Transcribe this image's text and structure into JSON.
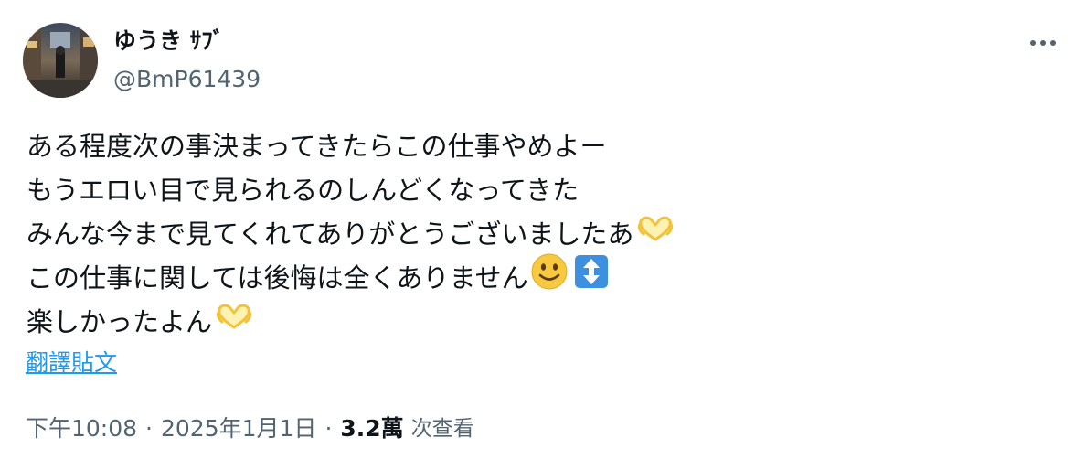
{
  "author": {
    "display_name": "ゆうき ｻﾌﾞ",
    "handle": "@BmP61439"
  },
  "tweet": {
    "lines": [
      {
        "text": "ある程度次の事決まってきたらこの仕事やめよー",
        "emojis": []
      },
      {
        "text": "もうエロい目で見られるのしんどくなってきた",
        "emojis": []
      },
      {
        "text": "みんな今まで見てくれてありがとうございましたあ",
        "emojis": [
          "heart-hands"
        ]
      },
      {
        "text": "この仕事に関しては後悔は全くありません",
        "emojis": [
          "slightly-smiling-face",
          "up-down-arrow"
        ]
      },
      {
        "text": "楽しかったよん",
        "emojis": [
          "heart-hands"
        ]
      }
    ]
  },
  "translate_label": "翻譯貼文",
  "meta": {
    "time": "下午10:08",
    "separator": "·",
    "date": "2025年1月1日",
    "views_count": "3.2萬",
    "views_label": "次查看"
  },
  "icons": {
    "more": "more-horizontal-icon"
  },
  "colors": {
    "text": "#0f1419",
    "secondary": "#536471",
    "link": "#1d9bf0"
  }
}
